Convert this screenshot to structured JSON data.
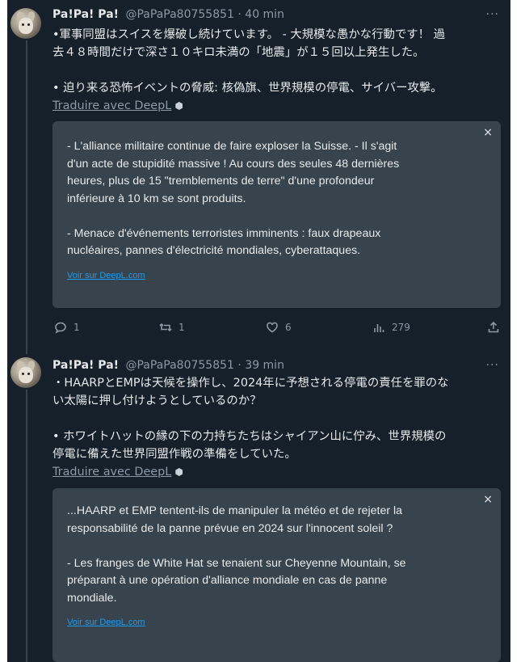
{
  "tweets": [
    {
      "name": "Pa!Pa! Pa!",
      "handle": "@PaPaPa80755851",
      "sep": "·",
      "time": "40 min",
      "more": "···",
      "lines": [
        "•軍事同盟はスイスを爆破し続けています。 - 大規模な愚かな行動です！ 過",
        "去４８時間だけで深さ１０キロ未満の「地震」が１５回以上発生した。",
        "",
        "• 迫り来る恐怖イベントの脅威: 核偽旗、世界規模の停電、サイバー攻撃。"
      ],
      "translate_label": "Traduire avec DeepL",
      "card": {
        "close": "×",
        "lines": [
          "- L'alliance militaire continue de faire exploser la Suisse. - Il s'agit",
          "d'un acte de stupidité massive ! Au cours des seules 48 dernières",
          "heures, plus de 15 \"tremblements de terre\" d'une profondeur",
          "inférieure à 10 km se sont produits.",
          "",
          "- Menace d'événements terroristes imminents : faux drapeaux",
          "nucléaires, pannes d'électricité mondiales, cyberattaques."
        ],
        "deepl_link": "Voir sur DeepL.com"
      },
      "actions": {
        "reply_count": "1",
        "retweet_count": "1",
        "like_count": "6",
        "views_count": "279"
      }
    },
    {
      "name": "Pa!Pa! Pa!",
      "handle": "@PaPaPa80755851",
      "sep": "·",
      "time": "39 min",
      "more": "···",
      "lines": [
        "・HAARPとEMPは天候を操作し、2024年に予想される停電の責任を罪のな",
        "い太陽に押し付けようとしているのか？",
        "",
        "• ホワイトハットの縁の下の力持ちたちはシャイアン山に佇み、世界規模の",
        "停電に備えた世界同盟作戦の準備をしていた。"
      ],
      "translate_label": "Traduire avec DeepL",
      "card": {
        "close": "×",
        "lines": [
          "...HAARP et EMP tentent-ils de manipuler la météo et de rejeter la",
          "responsabilité de la panne prévue en 2024 sur l'innocent soleil ?",
          "",
          "- Les franges de White Hat se tenaient sur Cheyenne Mountain, se",
          "préparant à une opération d'alliance mondiale en cas de panne",
          "mondiale."
        ],
        "deepl_link": "Voir sur DeepL.com"
      }
    }
  ],
  "icons": {
    "reply": "reply-icon",
    "retweet": "retweet-icon",
    "like": "heart-icon",
    "views": "views-icon",
    "share": "share-icon",
    "gem": "deepl-gem-icon"
  },
  "colors": {
    "background": "#15202b",
    "card": "#38444d",
    "text": "#e7e9ea",
    "muted": "#8b98a5",
    "link": "#1d9bf0"
  }
}
